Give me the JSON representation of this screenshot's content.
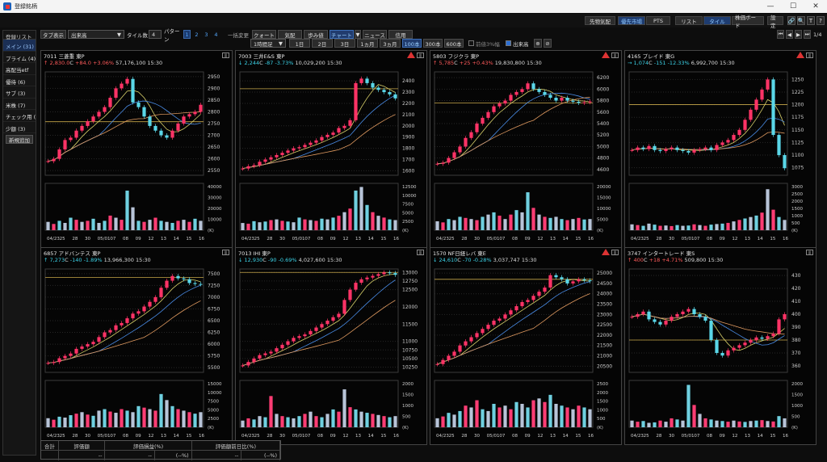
{
  "window": {
    "title": "登録銘柄",
    "min": "—",
    "max": "☐",
    "close": "✕"
  },
  "topbar": {
    "labels": [
      "先物気配",
      "優先市場",
      "PTS",
      "リスト",
      "タイル",
      "株価ボード",
      "設定"
    ],
    "icons": [
      "🔗",
      "🔍",
      "T",
      "?"
    ]
  },
  "sidebar": {
    "title": "登録リスト",
    "items": [
      "メイン (31)",
      "プライム (4)",
      "高配当etf",
      "優待 (6)",
      "サブ (3)",
      "米株 (7)",
      "チェック用 (",
      "少額 (3)"
    ],
    "add": "新規追加"
  },
  "toolbar1": {
    "tab_display": "タブ表示",
    "sort": "出来高",
    "tile_count_label": "タイル数",
    "tile_count": "4",
    "pattern_label": "パターン",
    "patterns": [
      "1",
      "2",
      "3",
      "4"
    ],
    "bulk_change": "一括変更",
    "tabs": [
      "クォート",
      "気配",
      "歩み値",
      "チャート",
      "▼",
      "ニュース",
      "信用"
    ],
    "page_indicator": "1/4"
  },
  "toolbar2": {
    "interval": "1時間足",
    "periods": [
      "1日",
      "2日",
      "3日",
      "1ヵ月",
      "3ヵ月",
      "100本",
      "300本",
      "600本"
    ],
    "check1": "前値3%幅",
    "check2": "出来高"
  },
  "colors": {
    "up": "#ff5b5b",
    "down": "#3cd3e8",
    "bg": "#050505",
    "accent": "#3d6fb8"
  },
  "panels": [
    {
      "header": "7011  三菱重   東P",
      "arrow": "↑",
      "price": "2,830.0",
      "flag": "C",
      "change": "+84.0 +3.06%",
      "dir": "up",
      "volume": "57,176,100  15:30",
      "yticks": [
        "2950",
        "2900",
        "2850",
        "2800",
        "2750",
        "2700",
        "2650",
        "2600",
        "2550"
      ],
      "vticks": [
        "40000",
        "30000",
        "20000",
        "10000",
        "(K)"
      ],
      "dates": [
        "04/23",
        "25",
        "28",
        "30",
        "05/01",
        "07",
        "08",
        "09",
        "12",
        "13",
        "14",
        "15",
        "16"
      ],
      "ymin": 2530,
      "ymax": 2970,
      "vmax": 45000,
      "close": [
        2590,
        2600,
        2640,
        2680,
        2690,
        2720,
        2740,
        2760,
        2780,
        2800,
        2820,
        2860,
        2900,
        2920,
        2940,
        2840,
        2820,
        2780,
        2740,
        2720,
        2700,
        2690,
        2720,
        2750,
        2780,
        2790,
        2800,
        2830
      ],
      "ref": 2758,
      "vol": [
        8000,
        6000,
        9000,
        7000,
        12000,
        10000,
        8000,
        9000,
        11000,
        7000,
        9000,
        14000,
        12000,
        10000,
        38000,
        22000,
        9000,
        8000,
        10000,
        12000,
        9000,
        8000,
        7000,
        9000,
        10000,
        8000,
        11000,
        9000
      ],
      "ind": false
    },
    {
      "header": "7003  三井E&S   東P",
      "arrow": "↓",
      "price": "2,244",
      "flag": "C",
      "change": "-87 -3.73%",
      "dir": "down",
      "volume": "10,029,200  15:30",
      "yticks": [
        "2400",
        "2300",
        "2200",
        "2100",
        "2000",
        "1900",
        "1800",
        "1700",
        "1600"
      ],
      "vticks": [
        "12500",
        "10000",
        "7500",
        "5000",
        "2500",
        "(K)"
      ],
      "dates": [
        "04/23",
        "25",
        "28",
        "30",
        "05/01",
        "07",
        "08",
        "09",
        "12",
        "13",
        "14",
        "15",
        "16"
      ],
      "ymin": 1560,
      "ymax": 2480,
      "vmax": 13000,
      "close": [
        1620,
        1640,
        1650,
        1680,
        1700,
        1720,
        1740,
        1760,
        1780,
        1800,
        1810,
        1830,
        1850,
        1870,
        1900,
        1920,
        1940,
        1980,
        2000,
        2050,
        2380,
        2420,
        2380,
        2340,
        2320,
        2300,
        2280,
        2244
      ],
      "ref": 2330,
      "vol": [
        2000,
        1800,
        2500,
        2200,
        2400,
        2800,
        3000,
        2600,
        2400,
        2200,
        3500,
        3000,
        2800,
        2600,
        3200,
        3000,
        3500,
        4000,
        5000,
        6000,
        11000,
        12000,
        7000,
        5000,
        4000,
        3500,
        3000,
        2800
      ],
      "ind": true
    },
    {
      "header": "5803  フジクラ   東P",
      "arrow": "↑",
      "price": "5,785",
      "flag": "C",
      "change": "+25 +0.43%",
      "dir": "up",
      "volume": "19,830,800  15:30",
      "yticks": [
        "6200",
        "6000",
        "5800",
        "5600",
        "5400",
        "5200",
        "5000",
        "4800",
        "4600"
      ],
      "vticks": [
        "20000",
        "15000",
        "10000",
        "5000",
        "(K)"
      ],
      "dates": [
        "04/23",
        "25",
        "28",
        "30",
        "05/01",
        "07",
        "08",
        "09",
        "12",
        "13",
        "14",
        "15",
        "16"
      ],
      "ymin": 4500,
      "ymax": 6300,
      "vmax": 21000,
      "close": [
        4700,
        4720,
        4800,
        4900,
        5000,
        5150,
        5250,
        5400,
        5500,
        5600,
        5700,
        5750,
        5800,
        5900,
        5950,
        6000,
        6100,
        6000,
        5950,
        5900,
        5850,
        5800,
        5850,
        5800,
        5780,
        5760,
        5770,
        5785
      ],
      "ref": 5760,
      "vol": [
        4000,
        3500,
        5000,
        4500,
        6000,
        5500,
        5000,
        4500,
        6000,
        7000,
        8000,
        6500,
        5000,
        7000,
        9000,
        8000,
        17000,
        10000,
        7000,
        6000,
        5500,
        6000,
        5000,
        4500,
        5000,
        5500,
        4800,
        5000
      ],
      "ind": true
    },
    {
      "header": "4165  プレイド   東G",
      "arrow": "→",
      "price": "1,074",
      "flag": "C",
      "change": "-151 -12.33%",
      "dir": "down",
      "volume": "6,992,700  15:30",
      "yticks": [
        "1250",
        "1225",
        "1200",
        "1175",
        "1150",
        "1125",
        "1100",
        "1075"
      ],
      "vticks": [
        "3000",
        "2500",
        "2000",
        "1500",
        "1000",
        "500",
        "(K)"
      ],
      "dates": [
        "04/23",
        "25",
        "28",
        "30",
        "05/01",
        "07",
        "08",
        "09",
        "12",
        "13",
        "14",
        "15",
        "16"
      ],
      "ymin": 1060,
      "ymax": 1265,
      "vmax": 3200,
      "close": [
        1110,
        1115,
        1112,
        1118,
        1110,
        1108,
        1112,
        1115,
        1110,
        1108,
        1105,
        1110,
        1112,
        1115,
        1110,
        1120,
        1125,
        1130,
        1140,
        1150,
        1170,
        1190,
        1210,
        1230,
        1250,
        1140,
        1100,
        1074
      ],
      "ref": 1200,
      "vol": [
        400,
        350,
        300,
        450,
        380,
        300,
        320,
        280,
        350,
        300,
        320,
        400,
        350,
        300,
        380,
        420,
        450,
        500,
        600,
        700,
        800,
        900,
        1000,
        1200,
        2800,
        1400,
        900,
        700
      ],
      "ind": true
    },
    {
      "header": "6857  アドバンテス   東P",
      "arrow": "↑",
      "price": "7,273",
      "flag": "C",
      "change": "-140 -1.89%",
      "dir": "down",
      "volume": "13,966,300  15:30",
      "yticks": [
        "7500",
        "7250",
        "7000",
        "6750",
        "6500",
        "6250",
        "6000",
        "5750",
        "5500"
      ],
      "vticks": [
        "15000",
        "10000",
        "7500",
        "5000",
        "2500",
        "(K)"
      ],
      "dates": [
        "04/23",
        "25",
        "28",
        "30",
        "05/01",
        "07",
        "08",
        "09",
        "12",
        "13",
        "14",
        "15",
        "16"
      ],
      "ymin": 5400,
      "ymax": 7600,
      "vmax": 15500,
      "close": [
        5600,
        5620,
        5700,
        5750,
        5800,
        5900,
        5950,
        6000,
        6050,
        6150,
        6250,
        6300,
        6400,
        6450,
        6550,
        6650,
        6700,
        6800,
        6900,
        7000,
        7200,
        7350,
        7450,
        7400,
        7380,
        7300,
        7280,
        7273
      ],
      "ref": 7420,
      "vol": [
        3000,
        2500,
        3500,
        3200,
        4000,
        4500,
        5000,
        4200,
        3800,
        5500,
        6000,
        5200,
        4800,
        6000,
        5500,
        5000,
        7000,
        6500,
        6000,
        5500,
        11000,
        9000,
        7000,
        6000,
        5500,
        5000,
        4500,
        5000
      ],
      "ind": false
    },
    {
      "header": "7013  IHI   東P",
      "arrow": "↓",
      "price": "12,930",
      "flag": "C",
      "change": "-90 -0.69%",
      "dir": "down",
      "volume": "4,027,600  15:30",
      "yticks": [
        "13000",
        "12750",
        "12500",
        "12000",
        "11500",
        "11000",
        "10750",
        "10500",
        "10250"
      ],
      "vticks": [
        "2000",
        "1500",
        "1000",
        "500",
        "(K)"
      ],
      "dates": [
        "04/23",
        "25",
        "28",
        "30",
        "05/01",
        "07",
        "08",
        "09",
        "12",
        "13",
        "14",
        "15",
        "16"
      ],
      "ymin": 10100,
      "ymax": 13100,
      "vmax": 2100,
      "close": [
        10300,
        10400,
        10500,
        10600,
        10650,
        10700,
        10800,
        10900,
        11000,
        11100,
        11150,
        11200,
        11300,
        11400,
        11500,
        11600,
        11700,
        11800,
        12200,
        12500,
        12700,
        12800,
        12850,
        12900,
        12950,
        13000,
        12980,
        12930
      ],
      "ref": 13000,
      "vol": [
        300,
        400,
        350,
        500,
        450,
        1400,
        600,
        500,
        450,
        400,
        500,
        600,
        700,
        500,
        450,
        600,
        800,
        700,
        1700,
        900,
        800,
        700,
        650,
        600,
        550,
        500,
        450,
        500
      ],
      "ind": false
    },
    {
      "header": "1570  NF日経レバ   東E",
      "arrow": "↓",
      "price": "24,610",
      "flag": "C",
      "change": "-70 -0.28%",
      "dir": "down",
      "volume": "3,037,747  15:30",
      "yticks": [
        "25000",
        "24500",
        "24000",
        "23500",
        "23000",
        "22500",
        "22000",
        "21500",
        "21000",
        "20500"
      ],
      "vticks": [
        "2500",
        "2000",
        "1500",
        "1000",
        "500",
        "(K)"
      ],
      "dates": [
        "04/23",
        "25",
        "28",
        "30",
        "05/01",
        "07",
        "08",
        "09",
        "12",
        "13",
        "14",
        "15",
        "16"
      ],
      "ymin": 20200,
      "ymax": 25200,
      "vmax": 2600,
      "close": [
        20600,
        20800,
        21000,
        21200,
        21500,
        21700,
        21900,
        22100,
        22300,
        22500,
        22700,
        22800,
        23000,
        23200,
        23400,
        23600,
        23700,
        23900,
        24100,
        24300,
        24900,
        24800,
        24700,
        24500,
        24600,
        24700,
        24650,
        24610
      ],
      "ref": 24700,
      "vol": [
        500,
        600,
        800,
        700,
        900,
        1200,
        1100,
        1500,
        1000,
        900,
        1300,
        1100,
        1200,
        1000,
        1400,
        1300,
        1100,
        1500,
        1600,
        1400,
        1800,
        1300,
        1200,
        1100,
        1000,
        1200,
        1100,
        1000
      ],
      "ind": true
    },
    {
      "header": "3747  インタートレード   東S",
      "arrow": "↑",
      "price": "400",
      "flag": "C",
      "change": "+18 +4.71%",
      "dir": "up",
      "volume": "509,800  15:30",
      "yticks": [
        "430",
        "420",
        "410",
        "400",
        "390",
        "380",
        "370",
        "360"
      ],
      "vticks": [
        "2000",
        "1500",
        "1000",
        "500",
        "(K)"
      ],
      "dates": [
        "04/23",
        "25",
        "28",
        "30",
        "05/01",
        "07",
        "08",
        "09",
        "12",
        "13",
        "14",
        "15",
        "16"
      ],
      "ymin": 355,
      "ymax": 435,
      "vmax": 2100,
      "close": [
        398,
        400,
        402,
        396,
        394,
        392,
        395,
        398,
        400,
        402,
        404,
        400,
        398,
        395,
        380,
        370,
        368,
        372,
        374,
        376,
        378,
        380,
        382,
        381,
        383,
        385,
        396,
        400
      ],
      "ref": 380,
      "vol": [
        300,
        250,
        280,
        200,
        220,
        300,
        250,
        400,
        350,
        300,
        1900,
        1000,
        600,
        400,
        350,
        300,
        280,
        250,
        300,
        260,
        240,
        280,
        300,
        320,
        280,
        260,
        500,
        400
      ],
      "ind": false
    }
  ],
  "summary": {
    "col0": "合計",
    "headers": [
      "評価額",
      "評価損益(%)",
      "評価額前日比(%)"
    ],
    "values": [
      "--",
      "--",
      "(--%)",
      "--",
      "(--%)"
    ]
  }
}
